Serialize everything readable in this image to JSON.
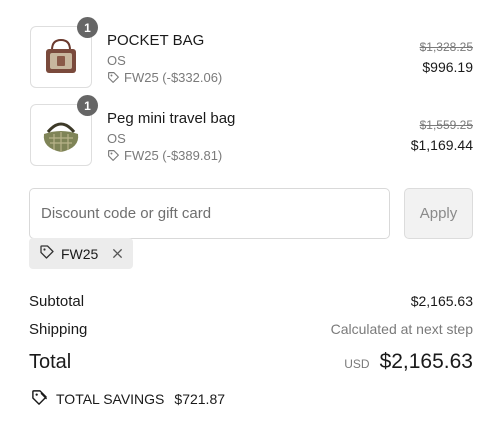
{
  "items": [
    {
      "quantity": "1",
      "name": "POCKET BAG",
      "variant": "OS",
      "discount": "FW25 (-$332.06)",
      "original_price": "$1,328.25",
      "price": "$996.19"
    },
    {
      "quantity": "1",
      "name": "Peg mini travel bag",
      "variant": "OS",
      "discount": "FW25 (-$389.81)",
      "original_price": "$1,559.25",
      "price": "$1,169.44"
    }
  ],
  "discount_form": {
    "placeholder": "Discount code or gift card",
    "value": "",
    "apply_label": "Apply"
  },
  "applied_code": "FW25",
  "summary": {
    "subtotal_label": "Subtotal",
    "subtotal_value": "$2,165.63",
    "shipping_label": "Shipping",
    "shipping_value": "Calculated at next step",
    "total_label": "Total",
    "currency": "USD",
    "total_value": "$2,165.63",
    "savings_label": "TOTAL SAVINGS",
    "savings_value": "$721.87"
  },
  "icons": [
    "tag-icon",
    "close-icon",
    "savings-tag-icon"
  ]
}
